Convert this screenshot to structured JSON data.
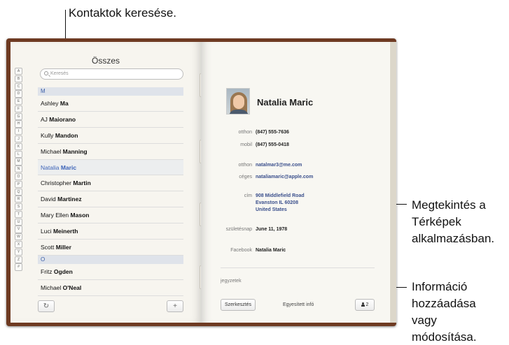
{
  "callouts": {
    "search": "Kontaktok keresése.",
    "maps_line1": "Megtekintés a",
    "maps_line2": "Térképek",
    "maps_line3": "alkalmazásban.",
    "edit_line1": "Információ",
    "edit_line2": "hozzáadása",
    "edit_line3": "vagy",
    "edit_line4": "módosítása."
  },
  "left_page": {
    "title": "Összes",
    "search_placeholder": "Keresés",
    "index_letters": [
      "A",
      "B",
      "C",
      "D",
      "E",
      "F",
      "G",
      "H",
      "I",
      "J",
      "K",
      "L",
      "M",
      "N",
      "O",
      "P",
      "Q",
      "R",
      "S",
      "T",
      "U",
      "V",
      "W",
      "X",
      "Y",
      "Z",
      "#"
    ],
    "sections": [
      {
        "header": "M",
        "contacts": [
          {
            "first": "Ashley",
            "last": "Ma",
            "selected": false
          },
          {
            "first": "AJ",
            "last": "Maiorano",
            "selected": false
          },
          {
            "first": "Kully",
            "last": "Mandon",
            "selected": false
          },
          {
            "first": "Michael",
            "last": "Manning",
            "selected": false
          },
          {
            "first": "Natalia",
            "last": "Maric",
            "selected": true
          },
          {
            "first": "Christopher",
            "last": "Martin",
            "selected": false
          },
          {
            "first": "David",
            "last": "Martinez",
            "selected": false
          },
          {
            "first": "Mary Ellen",
            "last": "Mason",
            "selected": false
          },
          {
            "first": "Luci",
            "last": "Meinerth",
            "selected": false
          },
          {
            "first": "Scott",
            "last": "Miller",
            "selected": false
          }
        ]
      },
      {
        "header": "O",
        "contacts": [
          {
            "first": "Fritz",
            "last": "Ogden",
            "selected": false
          },
          {
            "first": "Michael",
            "last": "O'Neal",
            "selected": false
          }
        ]
      }
    ],
    "toolbar": {
      "refresh_icon": "↻",
      "add_icon": "+"
    }
  },
  "right_page": {
    "name": "Natalia Maric",
    "fields": {
      "home_phone_label": "otthon",
      "home_phone": "(847) 555-7636",
      "mobile_label": "mobil",
      "mobile": "(847) 555-0418",
      "home_email_label": "otthon",
      "home_email": "natalmar3@me.com",
      "work_email_label": "céges",
      "work_email": "nataliamaric@apple.com",
      "address_label": "cím",
      "address_line1": "908 Middlefield Road",
      "address_line2": "Evanston IL 60208",
      "address_line3": "United States",
      "birthday_label": "születésnap",
      "birthday": "June 11, 1978",
      "facebook_label": "Facebook",
      "facebook": "Natalia Maric"
    },
    "notes_label": "jegyzetek",
    "toolbar": {
      "edit_label": "Szerkesztés",
      "unified_label": "Egyesített infó",
      "share_label": "2",
      "share_icon": "person-icon"
    }
  }
}
